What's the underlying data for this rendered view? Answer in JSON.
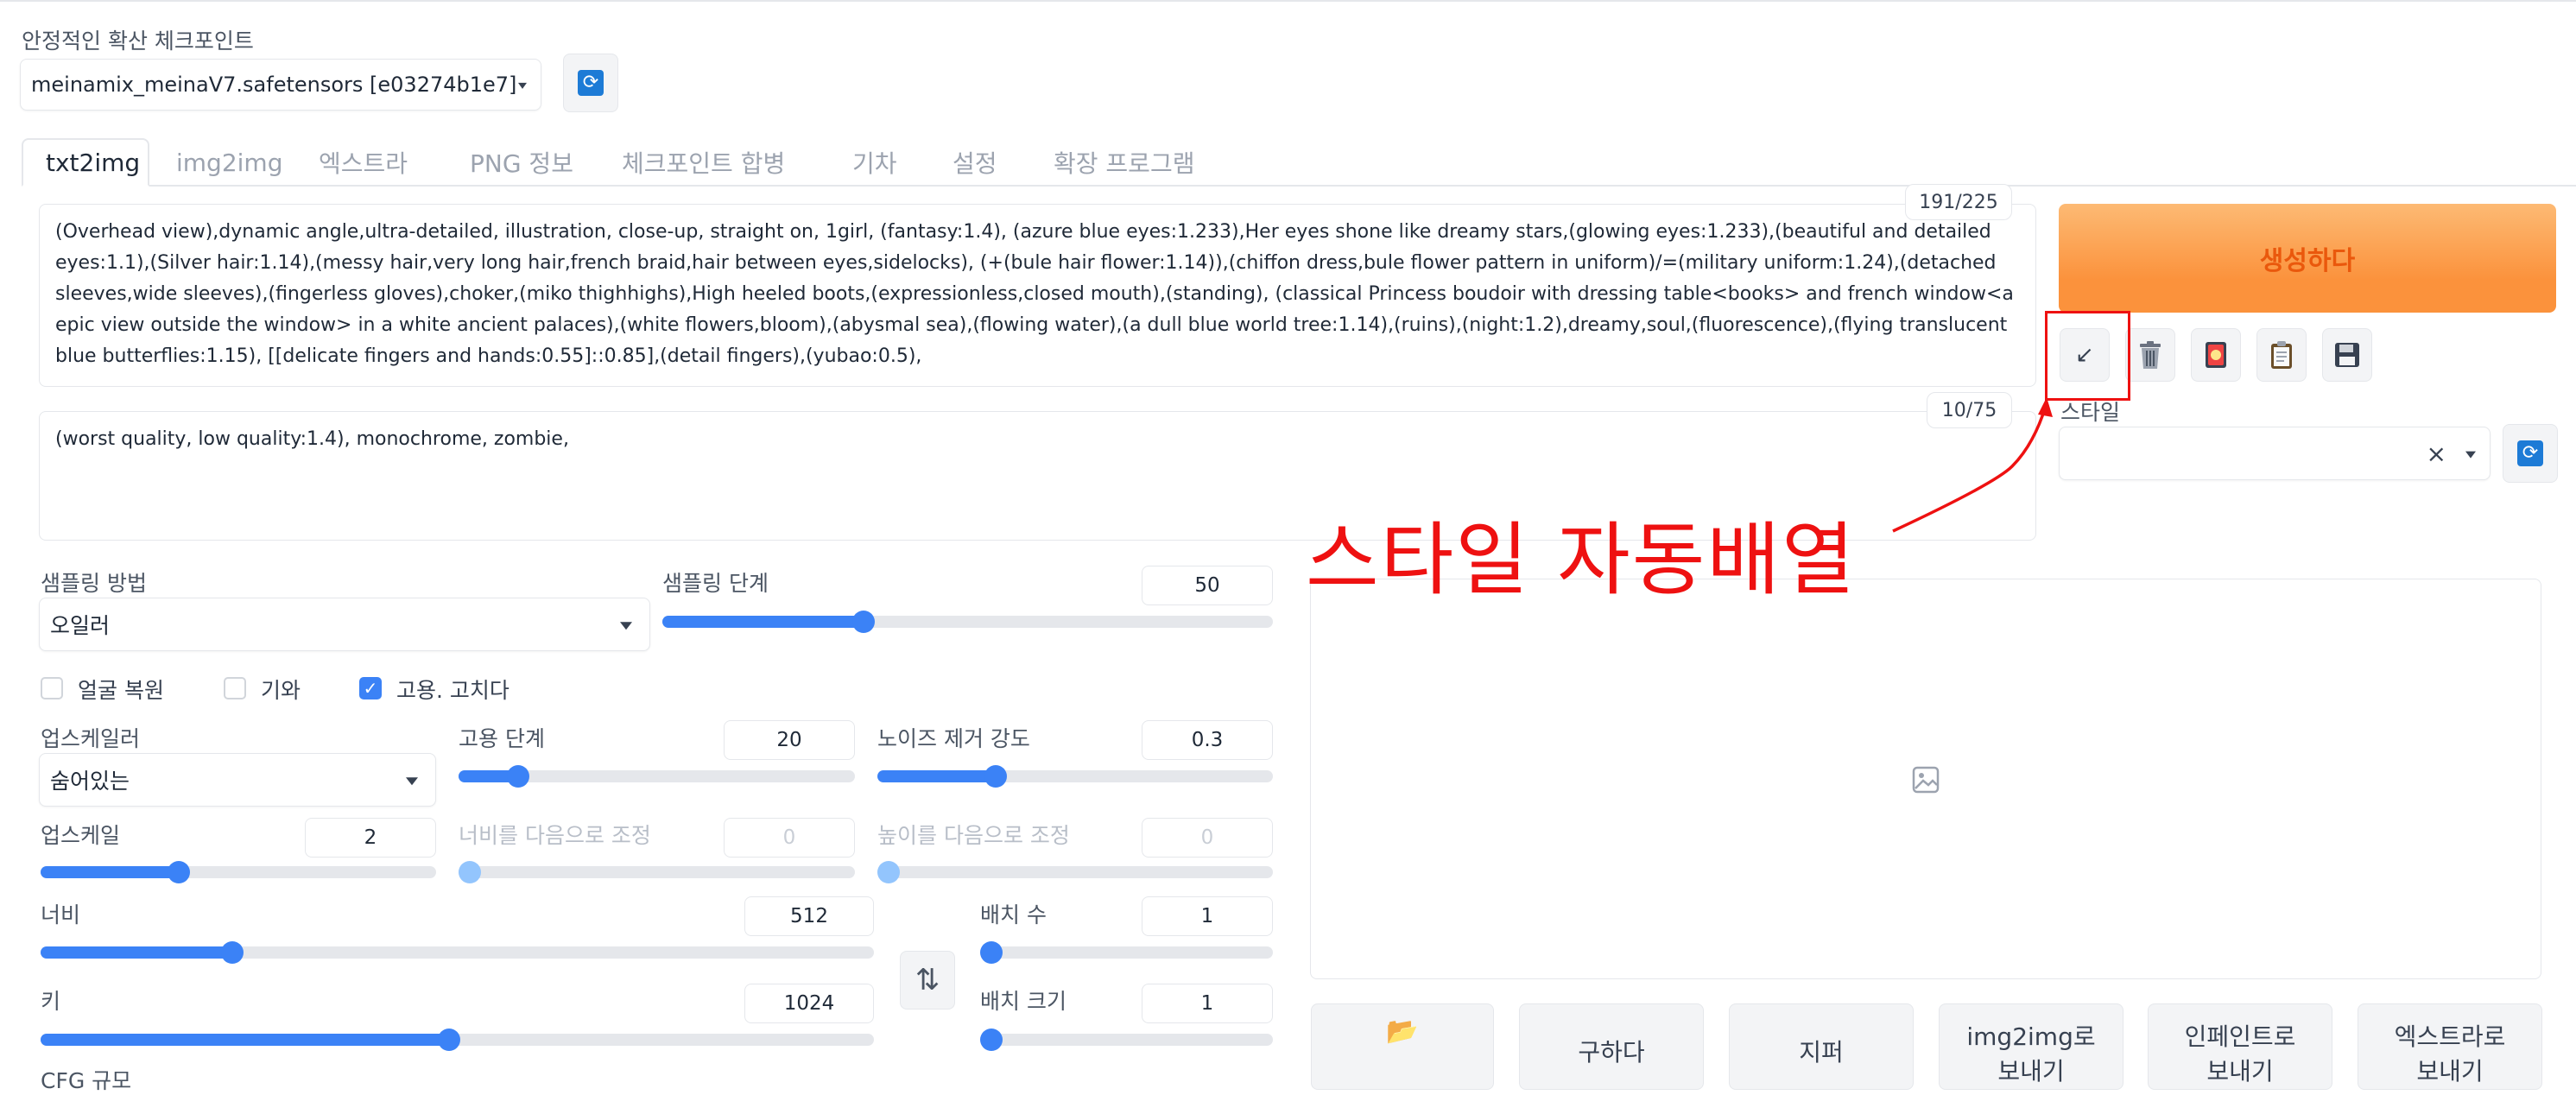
{
  "checkpoint": {
    "label": "안정적인 확산 체크포인트",
    "value": "meinamix_meinaV7.safetensors [e03274b1e7]"
  },
  "tabs": [
    {
      "label": "txt2img",
      "active": true
    },
    {
      "label": "img2img"
    },
    {
      "label": "엑스트라"
    },
    {
      "label": "PNG 정보"
    },
    {
      "label": "체크포인트 합병"
    },
    {
      "label": "기차"
    },
    {
      "label": "설정"
    },
    {
      "label": "확장 프로그램"
    }
  ],
  "prompt": {
    "counter": "191/225",
    "text": "(Overhead view),dynamic angle,ultra-detailed, illustration, close-up, straight on, 1girl, (fantasy:1.4), (azure blue eyes:1.233),Her eyes shone like dreamy stars,(glowing eyes:1.233),(beautiful and detailed eyes:1.1),(Silver hair:1.14),(messy hair,very long hair,french braid,hair between eyes,sidelocks), (+(bule hair flower:1.14)),(chiffon dress,bule flower pattern in uniform)/=(military uniform:1.24),(detached sleeves,wide sleeves),(fingerless gloves),choker,(miko thighhighs),High heeled boots,(expressionless,closed mouth),(standing), (classical Princess boudoir with dressing table<books> and french window<a epic view outside the window> in a white ancient palaces),(white flowers,bloom),(abysmal sea),(flowing water),(a dull blue world tree:1.14),(ruins),(night:1.2),dreamy,soul,(fluorescence),(flying translucent blue butterflies:1.15), [[delicate fingers and hands:0.55]::0.85],(detail fingers),(yubao:0.5),"
  },
  "negative_prompt": {
    "counter": "10/75",
    "text": "(worst quality, low quality:1.4), monochrome, zombie,"
  },
  "generate_label": "생성하다",
  "tool_icons": [
    "arrow-down-left-icon",
    "trash-icon",
    "red-card-icon",
    "clipboard-icon",
    "save-disk-icon"
  ],
  "styles": {
    "label": "스타일",
    "clear_symbol": "×"
  },
  "annotation": {
    "text": "스타일 자동배열",
    "color": "#ee1111"
  },
  "sampling": {
    "method_label": "샘플링 방법",
    "method_value": "오일러",
    "steps_label": "샘플링 단계",
    "steps_value": "50",
    "steps_fraction": 0.33
  },
  "checkboxes": [
    {
      "label": "얼굴 복원",
      "checked": false
    },
    {
      "label": "기와",
      "checked": false
    },
    {
      "label": "고용. 고치다",
      "checked": true
    }
  ],
  "hires": {
    "upscaler_label": "업스케일러",
    "upscaler_value": "숨어있는",
    "steps_label": "고용 단계",
    "steps_value": "20",
    "steps_fraction": 0.15,
    "denoise_label": "노이즈 제거 강도",
    "denoise_value": "0.3",
    "denoise_fraction": 0.3,
    "upscale_by_label": "업스케일",
    "upscale_by_value": "2",
    "upscale_by_fraction": 0.35,
    "resize_w_label": "너비를 다음으로 조정",
    "resize_w_value": "0",
    "resize_h_label": "높이를 다음으로 조정",
    "resize_h_value": "0"
  },
  "size": {
    "width_label": "너비",
    "width_value": "512",
    "width_fraction": 0.23,
    "height_label": "키",
    "height_value": "1024",
    "height_fraction": 0.49,
    "batch_count_label": "배치 수",
    "batch_count_value": "1",
    "batch_size_label": "배치 크기",
    "batch_size_value": "1",
    "swap_symbol": "⇅",
    "cfg_label": "CFG 규모"
  },
  "bottom_buttons": [
    {
      "label": "📂",
      "icon": "folder-icon"
    },
    {
      "label": "구하다"
    },
    {
      "label": "지퍼"
    },
    {
      "label": "img2img로\n보내기"
    },
    {
      "label": "인페인트로\n보내기"
    },
    {
      "label": "엑스트라로\n보내기"
    }
  ]
}
